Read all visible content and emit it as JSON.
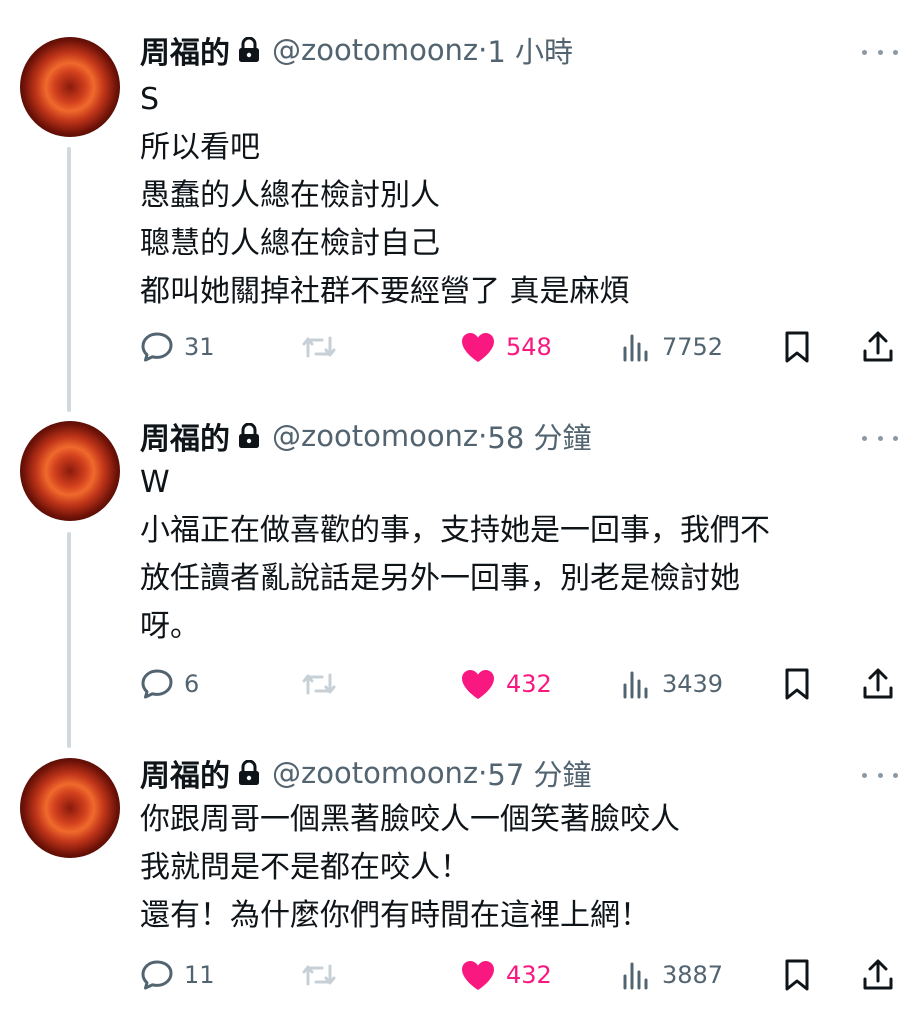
{
  "tweets": [
    {
      "name": "周福的",
      "handle": "@zootomoonz",
      "time": "1 小時",
      "lines": [
        "S",
        "所以看吧",
        "愚蠢的人總在檢討別人",
        "聰慧的人總在檢討自己",
        "都叫她關掉社群不要經營了 真是麻煩"
      ],
      "replies": "31",
      "retweets": "",
      "likes": "548",
      "views": "7752"
    },
    {
      "name": "周福的",
      "handle": "@zootomoonz",
      "time": "58 分鐘",
      "lines": [
        "W",
        "小福正在做喜歡的事，支持她是一回事，我們不",
        "放任讀者亂說話是另外一回事，別老是檢討她",
        "呀。"
      ],
      "replies": "6",
      "retweets": "",
      "likes": "432",
      "views": "3439"
    },
    {
      "name": "周福的",
      "handle": "@zootomoonz",
      "time": "57 分鐘",
      "lines": [
        "你跟周哥一個黑著臉咬人一個笑著臉咬人",
        "我就問是不是都在咬人！",
        "還有！為什麼你們有時間在這裡上網！"
      ],
      "replies": "11",
      "retweets": "",
      "likes": "432",
      "views": "3887"
    }
  ],
  "colors": {
    "like": "#f91880",
    "muted": "#536471",
    "text": "#0f1419",
    "thread": "#cfd9de"
  },
  "icons": [
    "lock-icon",
    "more-icon",
    "reply-icon",
    "retweet-icon",
    "like-icon",
    "views-icon",
    "bookmark-icon",
    "share-icon"
  ]
}
